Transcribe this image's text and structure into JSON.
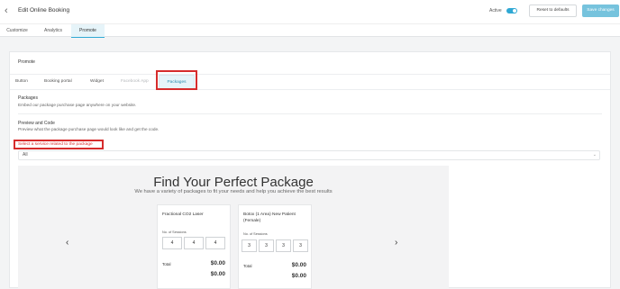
{
  "header": {
    "back_icon": "chevron-left-icon",
    "title": "Edit Online Booking",
    "active_label": "Active",
    "active_on": true,
    "reset_label": "Reset to defaults",
    "save_label": "Save changes",
    "accent_color": "#2fa8d4"
  },
  "tabs": [
    {
      "label": "Customize",
      "active": false
    },
    {
      "label": "Analytics",
      "active": false
    },
    {
      "label": "Promote",
      "active": true
    }
  ],
  "promote": {
    "title": "Promote",
    "subtabs": [
      {
        "label": "Button",
        "state": "normal"
      },
      {
        "label": "Booking portal",
        "state": "normal"
      },
      {
        "label": "Widget",
        "state": "normal"
      },
      {
        "label": "Facebook App",
        "state": "disabled"
      },
      {
        "label": "Packages",
        "state": "active"
      }
    ],
    "packages_title": "Packages",
    "packages_desc": "Embed our package purchase page anywhere on your website.",
    "preview_title": "Preview and Code",
    "preview_desc": "Preview what the package purchase page would look like and get the code.",
    "select_label": "Select a service related to the package",
    "select_value": "All"
  },
  "preview": {
    "headline": "Find Your Perfect Package",
    "subline": "We have a variety of packages to fit your needs and help you achieve the best results",
    "prev_icon": "chevron-left-icon",
    "next_icon": "chevron-right-icon",
    "cards": [
      {
        "name": "Fractional CO2 Laser",
        "sessions_label": "No. of Sessions",
        "sessions": [
          "4",
          "4",
          "4"
        ],
        "total_label": "Total",
        "price1": "$0.00",
        "price2": "$0.00"
      },
      {
        "name": "Botox (1 Area) New Patient (Female)",
        "sessions_label": "No. of Sessions",
        "sessions": [
          "3",
          "3",
          "3",
          "3"
        ],
        "total_label": "Total",
        "price1": "$0.00",
        "price2": "$0.00"
      }
    ]
  }
}
